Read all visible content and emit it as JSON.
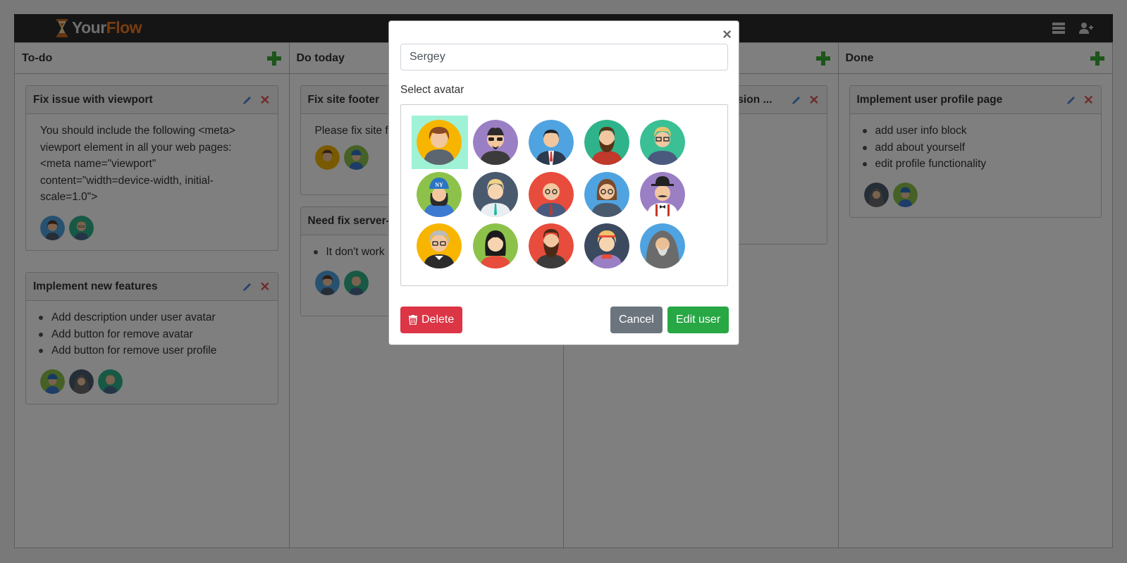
{
  "brand": {
    "part1": "Your",
    "part2": "Flow"
  },
  "columns": [
    {
      "title": "To-do"
    },
    {
      "title": "Do today"
    },
    {
      "title": ""
    },
    {
      "title": "Done"
    }
  ],
  "cards": {
    "c1": {
      "title": "Fix issue with viewport",
      "text": "You should include the following <meta> viewport element in all your web pages: <meta name=\"viewport\" content=\"width=device-width, initial-scale=1.0\">"
    },
    "c2": {
      "title": "Implement new features",
      "items": [
        "Add description under user avatar",
        "Add button for remove avatar",
        "Add button for remove user profile"
      ]
    },
    "c3": {
      "title": "Fix site footer",
      "text": "Please fix site f"
    },
    "c4": {
      "title": "Need fix server-",
      "items": [
        "It don't work"
      ]
    },
    "c5": {
      "title": "sion ..."
    },
    "c6": {
      "title": "Implement user profile page",
      "items": [
        "add user info block",
        "add about yourself",
        "edit profile functionality"
      ]
    }
  },
  "modal": {
    "name_value": "Sergey",
    "select_label": "Select avatar",
    "close": "×",
    "delete": "Delete",
    "cancel": "Cancel",
    "edit": "Edit user"
  },
  "colors": {
    "accent_green": "#28a745",
    "danger": "#dc3545",
    "selected_avatar_bg": "#9ff2d6",
    "brand_orange": "#f07822"
  }
}
